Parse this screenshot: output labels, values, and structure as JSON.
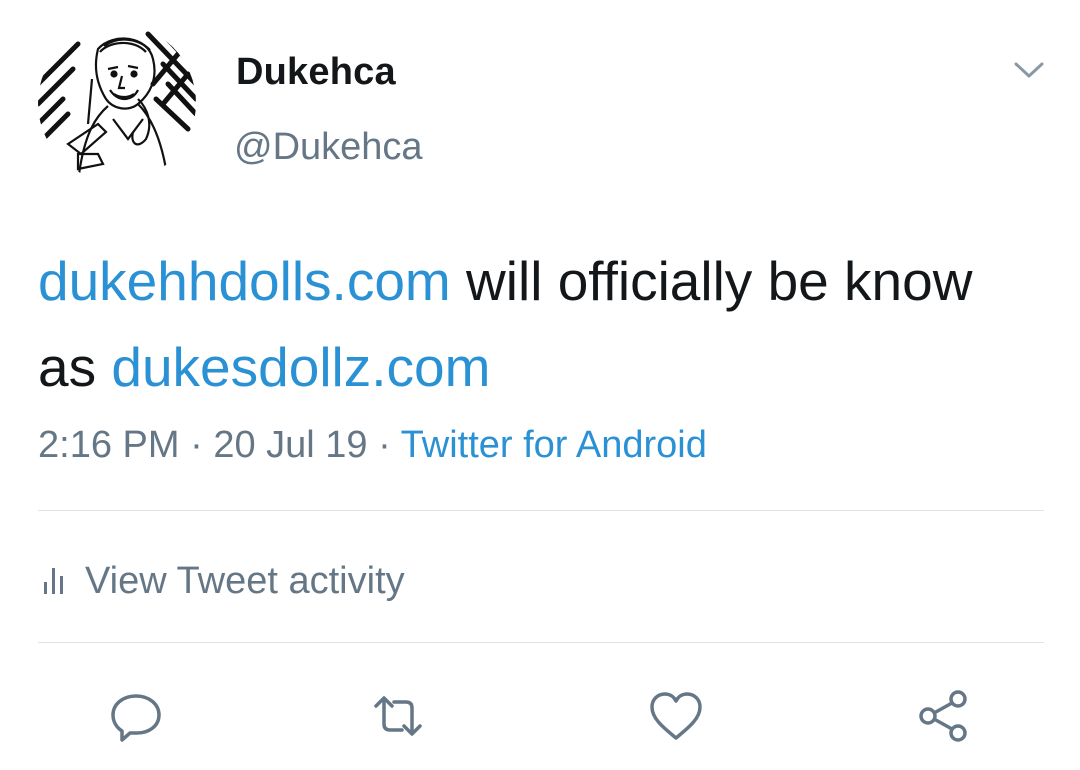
{
  "author": {
    "display_name": "Dukehca",
    "handle": "@Dukehca",
    "avatar_icon": "sketch-portrait-avatar"
  },
  "tweet": {
    "link1": "dukehhdolls.com",
    "text1": " will officially be know as ",
    "link2": "dukesdollz.com",
    "time": "2:16 PM",
    "sep1": " · ",
    "date": "20 Jul 19",
    "sep2": " · ",
    "source": "Twitter for Android"
  },
  "activity": {
    "label": "View Tweet activity",
    "icon": "bar-chart-icon"
  },
  "actions": {
    "reply_icon": "reply-icon",
    "retweet_icon": "retweet-icon",
    "like_icon": "heart-icon",
    "share_icon": "share-icon"
  },
  "colors": {
    "link": "#2a91d4",
    "secondary_text": "#657786",
    "primary_text": "#14171a",
    "divider": "#dfe3e6"
  }
}
